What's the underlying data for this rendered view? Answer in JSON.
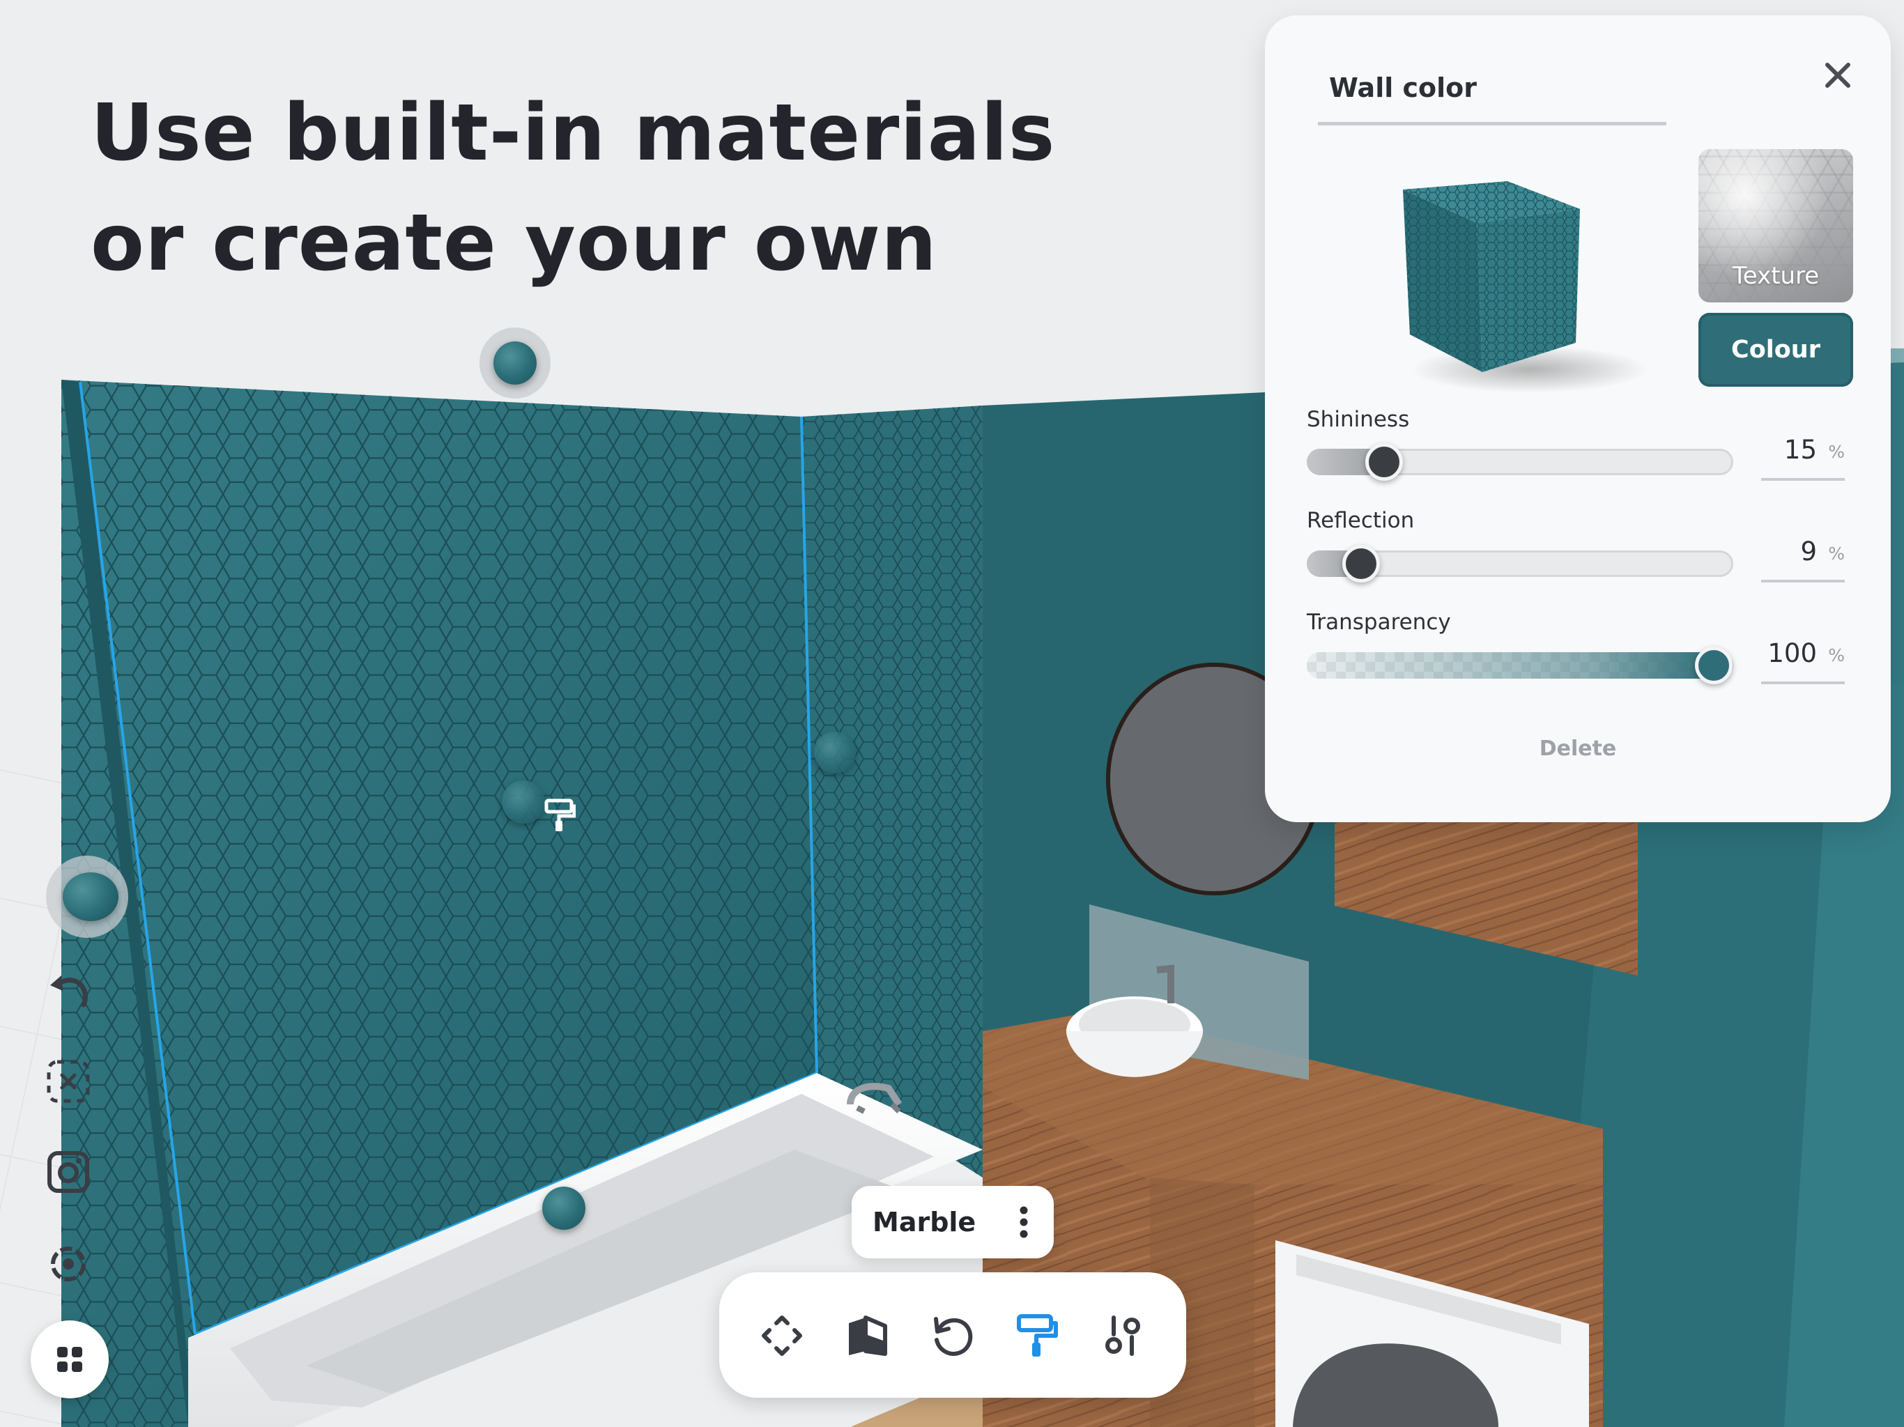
{
  "headline": {
    "line1": "Use built-in materials",
    "line2": "or create your own"
  },
  "panel": {
    "title": "Wall color",
    "texture_label": "Texture",
    "colour_label": "Colour",
    "sliders": [
      {
        "label": "Shininess",
        "value": "15",
        "unit": "%",
        "level": 0.15
      },
      {
        "label": "Reflection",
        "value": "9",
        "unit": "%",
        "level": 0.09
      },
      {
        "label": "Transparency",
        "value": "100",
        "unit": "%",
        "level": 1.0
      }
    ],
    "delete_label": "Delete"
  },
  "material_chip": {
    "name": "Marble"
  },
  "left_toolbar": {
    "icons": [
      "material-ball-icon",
      "undo-icon",
      "deselect-icon",
      "camera-icon",
      "focus-target-icon",
      "grid-menu-icon"
    ]
  },
  "bottom_toolbar": {
    "icons": [
      "move-icon",
      "material-icon",
      "rotate-icon",
      "paint-roller-icon",
      "adjust-icon"
    ],
    "active": "paint-roller-icon"
  },
  "colors": {
    "accent": "#2f6e78",
    "wall_tile": "#2a6c76",
    "active_icon": "#1e90e8",
    "headline": "#23242c"
  }
}
